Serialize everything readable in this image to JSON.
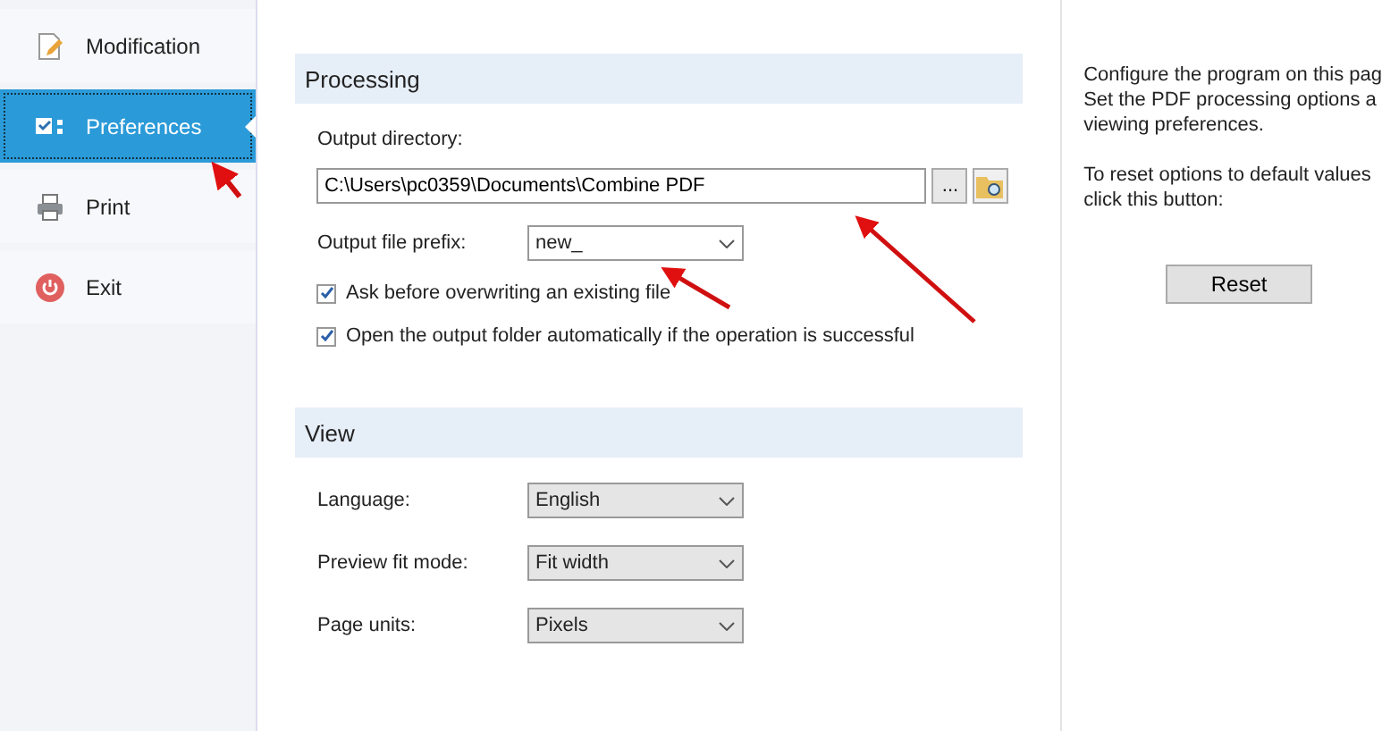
{
  "sidebar": {
    "items": [
      {
        "label": "Modification",
        "selected": false
      },
      {
        "label": "Preferences",
        "selected": true
      },
      {
        "label": "Print",
        "selected": false
      },
      {
        "label": "Exit",
        "selected": false
      }
    ]
  },
  "sections": [
    {
      "title": "Processing",
      "rows": [
        {
          "kind": "path",
          "label": "Output directory:",
          "value": "C:\\Users\\pc0359\\Documents\\Combine PDF",
          "browse": "..."
        },
        {
          "kind": "combo",
          "label": "Output file prefix:",
          "value": "new_",
          "editable": true
        },
        {
          "kind": "check",
          "label": "Ask before overwriting an existing file",
          "checked": true
        },
        {
          "kind": "check",
          "label": "Open the output folder automatically if the operation is successful",
          "checked": true
        }
      ]
    },
    {
      "title": "View",
      "rows": [
        {
          "kind": "combo",
          "label": "Language:",
          "value": "English",
          "editable": false
        },
        {
          "kind": "combo",
          "label": "Preview fit mode:",
          "value": "Fit width",
          "editable": false
        },
        {
          "kind": "combo",
          "label": "Page units:",
          "value": "Pixels",
          "editable": false
        }
      ]
    }
  ],
  "help": {
    "paragraphs": [
      [
        "Configure the program on this pag",
        "Set the PDF processing options a",
        "viewing preferences."
      ],
      [
        "To reset options to default values",
        "click this button:"
      ]
    ],
    "button": "Reset"
  }
}
